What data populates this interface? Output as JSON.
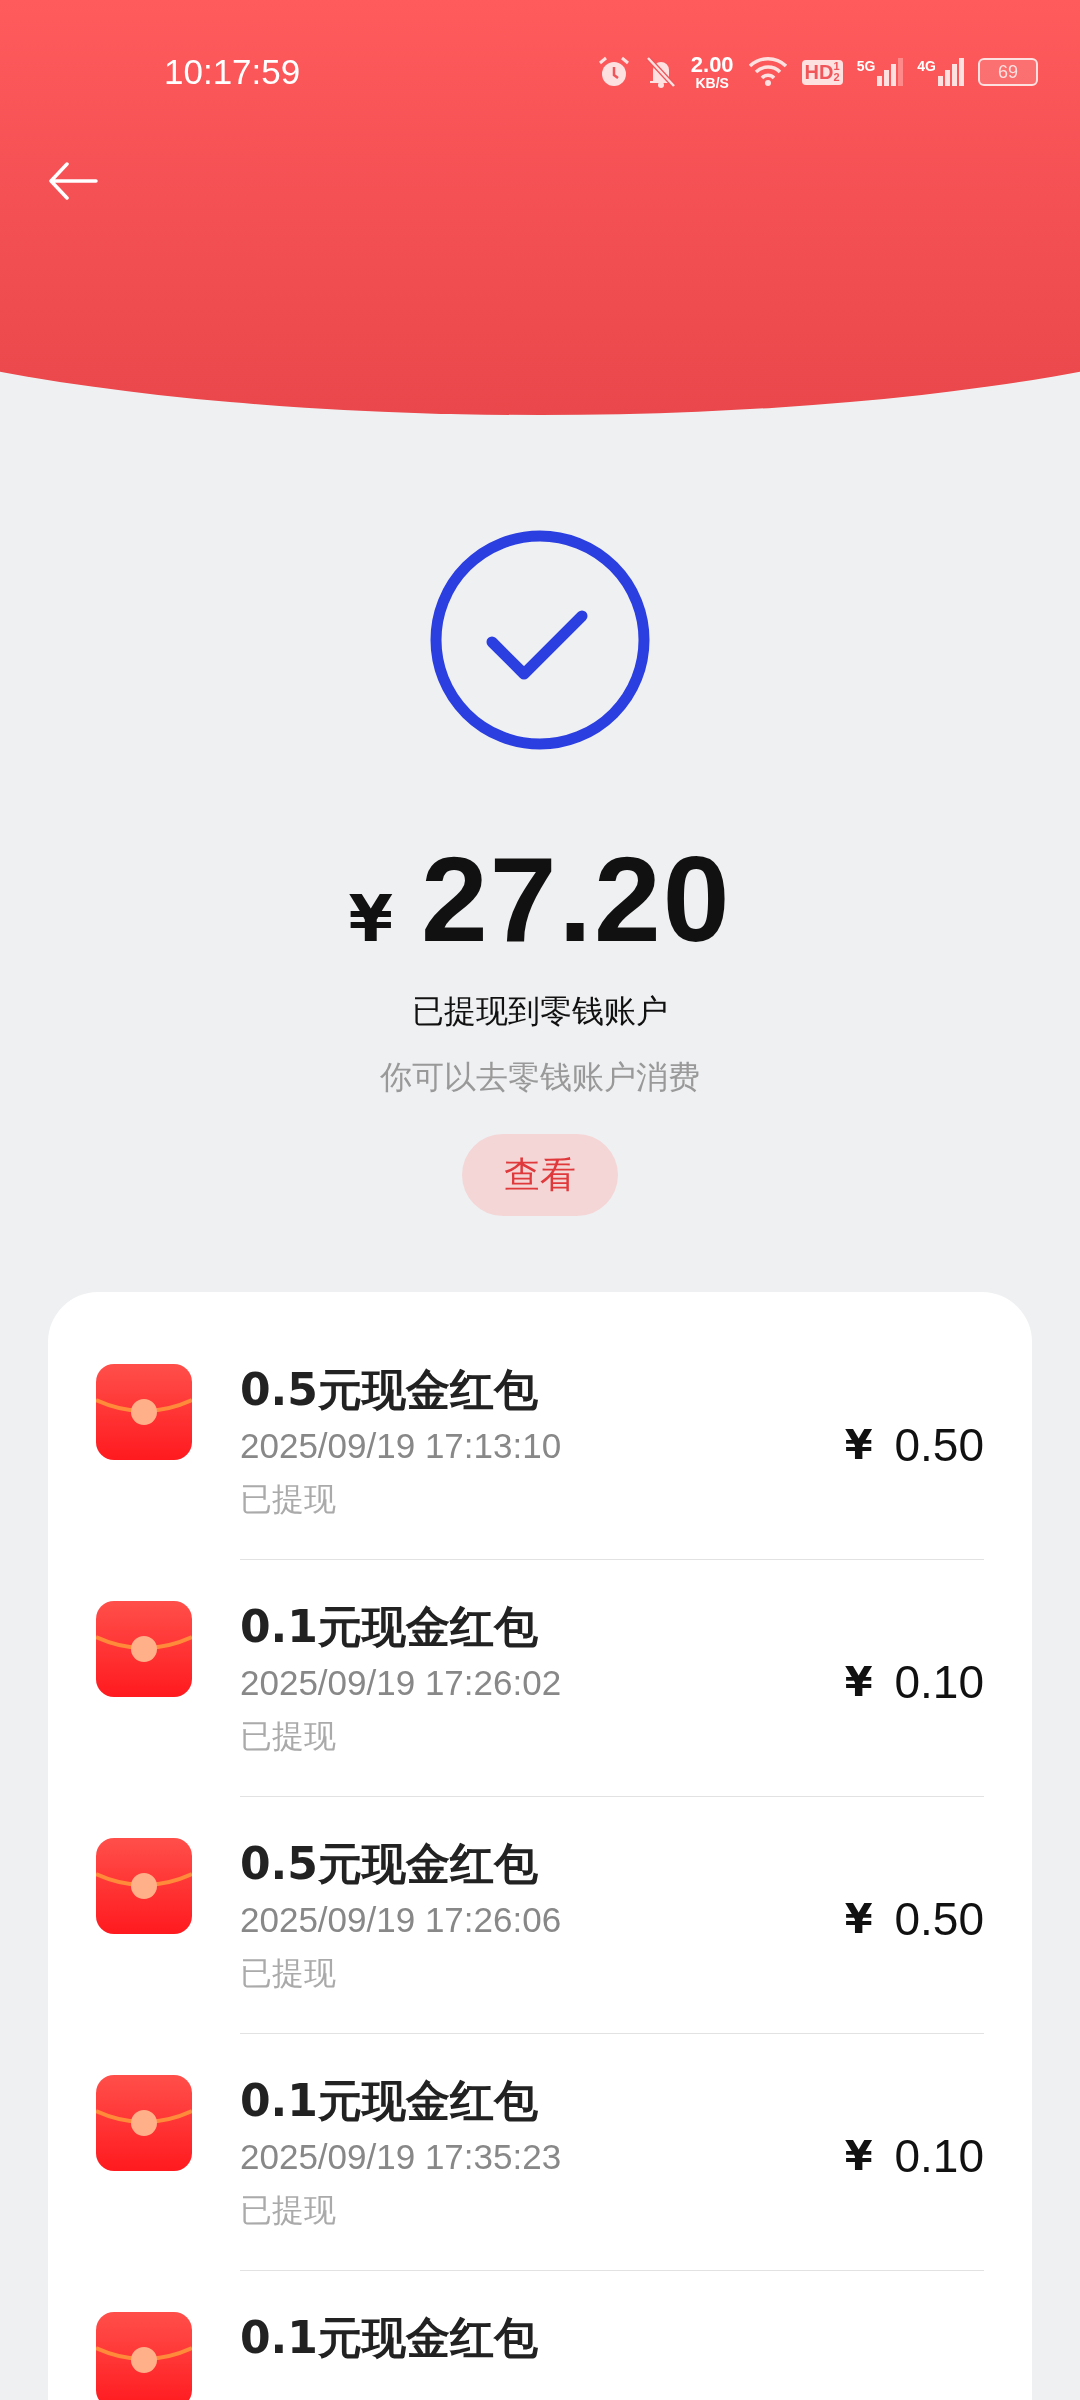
{
  "status_bar": {
    "time": "10:17:59",
    "net_speed": "2.00",
    "net_unit": "KB/S",
    "hd": "HD",
    "hd_sup": "1",
    "hd_sub": "2",
    "sim1": "5G",
    "sim2": "4G",
    "battery": "69"
  },
  "result": {
    "currency": "¥",
    "amount": "27.20",
    "title": "已提现到零钱账户",
    "subtitle": "你可以去零钱账户消费",
    "button": "查看"
  },
  "records": [
    {
      "title": "0.5元现金红包",
      "time": "2025/09/19 17:13:10",
      "status": "已提现",
      "currency": "¥",
      "amount": "0.50"
    },
    {
      "title": "0.1元现金红包",
      "time": "2025/09/19 17:26:02",
      "status": "已提现",
      "currency": "¥",
      "amount": "0.10"
    },
    {
      "title": "0.5元现金红包",
      "time": "2025/09/19 17:26:06",
      "status": "已提现",
      "currency": "¥",
      "amount": "0.50"
    },
    {
      "title": "0.1元现金红包",
      "time": "2025/09/19 17:35:23",
      "status": "已提现",
      "currency": "¥",
      "amount": "0.10"
    },
    {
      "title": "0.1元现金红包"
    }
  ]
}
